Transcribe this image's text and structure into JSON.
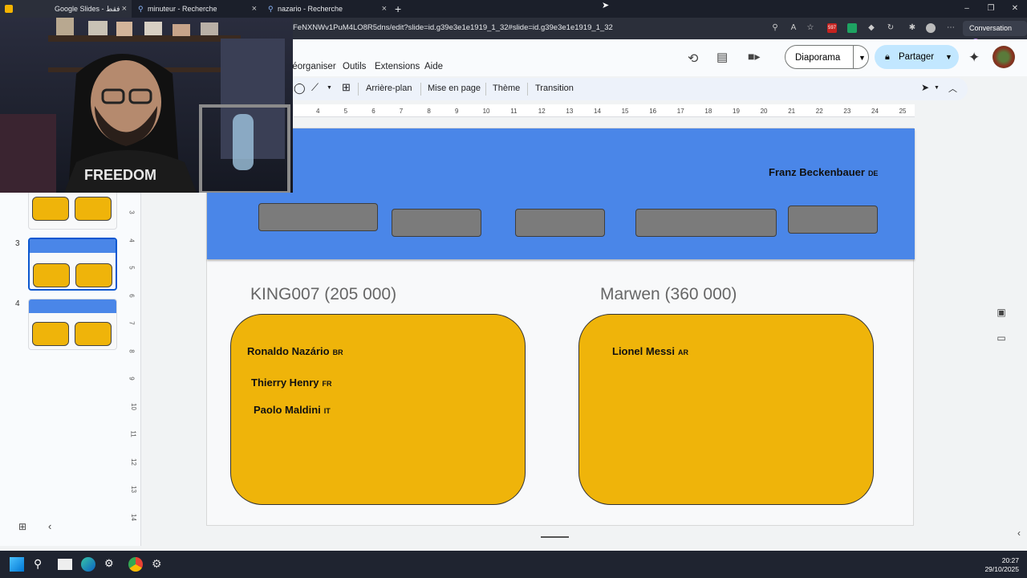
{
  "browser": {
    "tabs": [
      {
        "title": "Google Slides - ﻿فقط"
      },
      {
        "title": "minuteur - Recherche"
      },
      {
        "title": "nazario - Recherche"
      }
    ],
    "url": "FeNXNWv1PuM4LO8R5dns/edit?slide=id.g39e3e1e1919_1_32#slide=id.g39e3e1e1919_1_32",
    "badge_count": "597",
    "conversation_label": "Conversation"
  },
  "menubar": {
    "items": [
      "Réorganiser",
      "Outils",
      "Extensions",
      "Aide"
    ],
    "slideshow_label": "Diaporama",
    "share_label": "Partager"
  },
  "toolbar": {
    "items": [
      "Arrière-plan",
      "Mise en page",
      "Thème",
      "Transition"
    ]
  },
  "ruler": {
    "ticks": [
      "4",
      "5",
      "6",
      "7",
      "8",
      "9",
      "10",
      "11",
      "12",
      "13",
      "14",
      "15",
      "16",
      "17",
      "18",
      "19",
      "20",
      "21",
      "22",
      "23",
      "24",
      "25"
    ],
    "vticks": [
      "3",
      "4",
      "5",
      "6",
      "7",
      "8",
      "9",
      "10",
      "11",
      "12",
      "13",
      "14"
    ]
  },
  "sidebar": {
    "slide_numbers": [
      "3",
      "4"
    ]
  },
  "slide": {
    "banner_player": {
      "name": "Franz Beckenbauer",
      "country": "DE"
    },
    "left": {
      "heading": "KING007 (205 000)",
      "players": [
        {
          "name": "Ronaldo Nazário",
          "country": "BR"
        },
        {
          "name": "Thierry Henry",
          "country": "FR"
        },
        {
          "name": "Paolo Maldini",
          "country": "IT"
        }
      ]
    },
    "right": {
      "heading": "Marwen (360 000)",
      "players": [
        {
          "name": "Lionel Messi",
          "country": "AR"
        }
      ]
    }
  },
  "taskbar": {
    "time": "20:27",
    "date": "29/10/2025"
  },
  "colors": {
    "banner": "#4a86e8",
    "card": "#efb40a",
    "slot": "#7b7b7b"
  }
}
